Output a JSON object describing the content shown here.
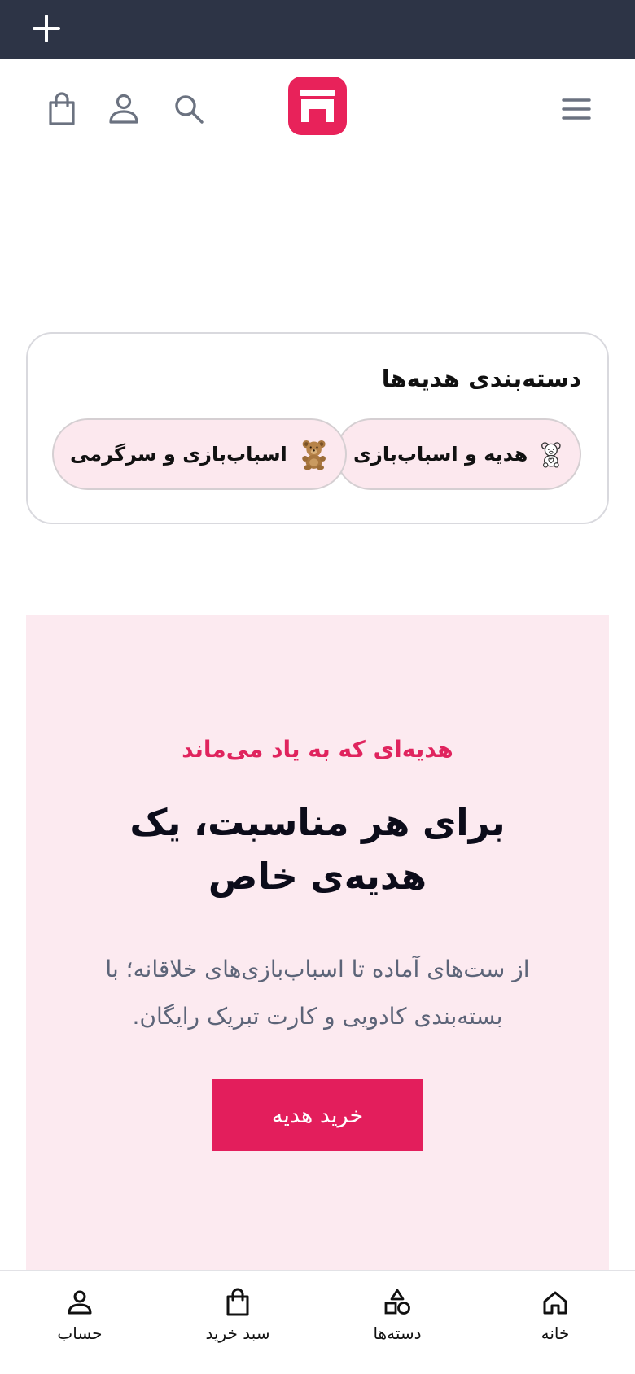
{
  "topbar": {
    "icon": "plus-icon"
  },
  "header": {
    "icons": [
      "menu-icon",
      "store-logo",
      "search-icon",
      "account-icon",
      "cart-icon"
    ]
  },
  "categories": {
    "title": "دسته‌بندی هدیه‌ها",
    "chips": [
      {
        "label": "هدیه و اسباب‌بازی",
        "icon": "teddy-outline-icon"
      },
      {
        "label": "اسباب‌بازی و سرگرمی",
        "icon": "teddy-bear-image"
      }
    ]
  },
  "hero": {
    "kicker": "هدیه‌ای که به یاد می‌ماند",
    "title": "برای هر مناسبت، یک هدیه‌ی خاص",
    "description": "از ست‌های آماده تا اسباب‌بازی‌های خلاقانه؛ با بسته‌بندی کادویی و کارت تبریک رایگان.",
    "button": "خرید هدیه"
  },
  "bottom_nav": {
    "home": "خانه",
    "categories": "دسته‌ها",
    "cart": "سبد خرید",
    "account": "حساب"
  },
  "colors": {
    "accent": "#e31e5c",
    "topbar": "#2d3446",
    "hero_bg": "#fceaf0",
    "chip_bg": "#fce8ee"
  }
}
